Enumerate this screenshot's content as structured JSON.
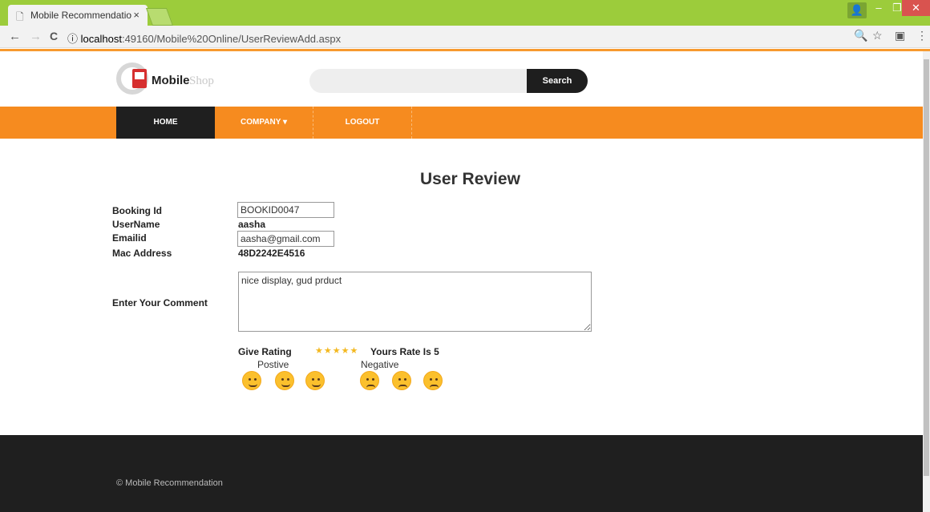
{
  "browser": {
    "tab_title": "Mobile Recommendatio",
    "tab_close": "×",
    "url_host": "localhost",
    "url_path": ":49160/Mobile%20Online/UserReviewAdd.aspx",
    "info_icon": "ⓘ"
  },
  "site": {
    "logo_main": "Mobile",
    "logo_sub": "Shop",
    "search_placeholder": "",
    "search_button": "Search"
  },
  "menu": {
    "home": "HOME",
    "company": "COMPANY ▾",
    "logout": "LOGOUT"
  },
  "form": {
    "title": "User Review",
    "booking_label": "Booking Id",
    "booking_value": "BOOKID0047",
    "username_label": "UserName",
    "username_value": "aasha",
    "email_label": "Emailid",
    "email_value": "aasha@gmail.com",
    "mac_label": "Mac Address",
    "mac_value": "48D2242E4516",
    "comment_label": "Enter Your Comment",
    "comment_value": "nice display, gud prduct",
    "rating_label": "Give Rating",
    "stars": "★★★★★",
    "rating_value": 5,
    "rate_text": "Yours Rate Is 5",
    "positive_label": "Postive",
    "negative_label": "Negative"
  },
  "footer": {
    "copyright": "© Mobile Recommendation"
  },
  "icons": {
    "positive": [
      "tongue-wink-emoji-icon",
      "laughing-emoji-icon",
      "smile-emoji-icon"
    ],
    "negative": [
      "confused-emoji-icon",
      "sweat-emoji-icon",
      "angry-emoji-icon"
    ]
  }
}
